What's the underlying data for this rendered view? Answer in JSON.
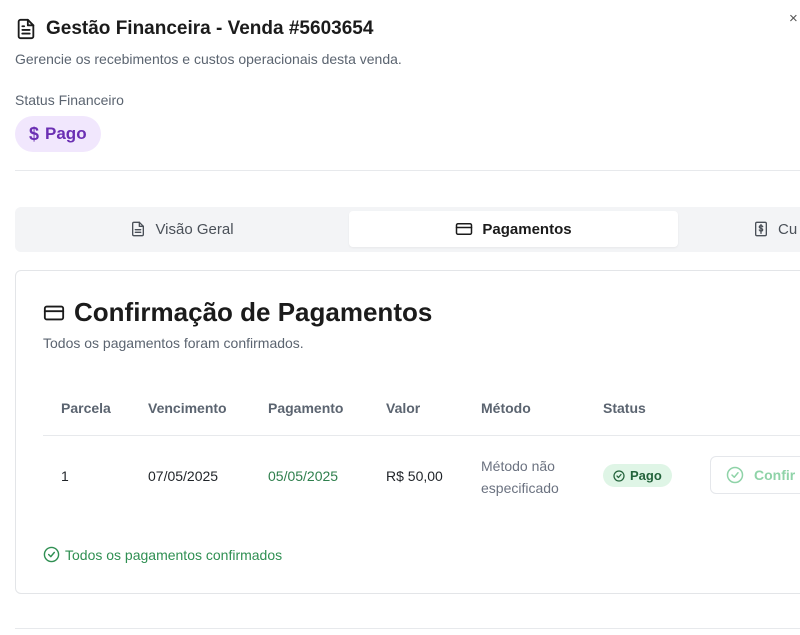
{
  "header": {
    "title": "Gestão Financeira - Venda #5603654",
    "subtitle": "Gerencie os recebimentos e custos operacionais desta venda.",
    "close_label": "×"
  },
  "status": {
    "label": "Status Financeiro",
    "badge_symbol": "$",
    "badge_text": "Pago",
    "badge_color": "#6b2fb3"
  },
  "tabs": [
    {
      "label": "Visão Geral",
      "icon": "document-icon",
      "active": false
    },
    {
      "label": "Pagamentos",
      "icon": "credit-card-icon",
      "active": true
    },
    {
      "label": "Cu",
      "icon": "receipt-dollar-icon",
      "active": false
    }
  ],
  "payments": {
    "title": "Confirmação de Pagamentos",
    "description": "Todos os pagamentos foram confirmados.",
    "columns": [
      "Parcela",
      "Vencimento",
      "Pagamento",
      "Valor",
      "Método",
      "Status"
    ],
    "rows": [
      {
        "parcela": "1",
        "vencimento": "07/05/2025",
        "pagamento": "05/05/2025",
        "valor": "R$ 50,00",
        "metodo_line1": "Método não",
        "metodo_line2": "especificado",
        "status": "Pago",
        "action_label": "Confir"
      }
    ],
    "footer_note": "Todos os pagamentos confirmados"
  },
  "colors": {
    "accent_green": "#2f8f52",
    "paid_badge_bg": "#dff5e6",
    "purple_badge_bg": "#f1e7fd"
  }
}
